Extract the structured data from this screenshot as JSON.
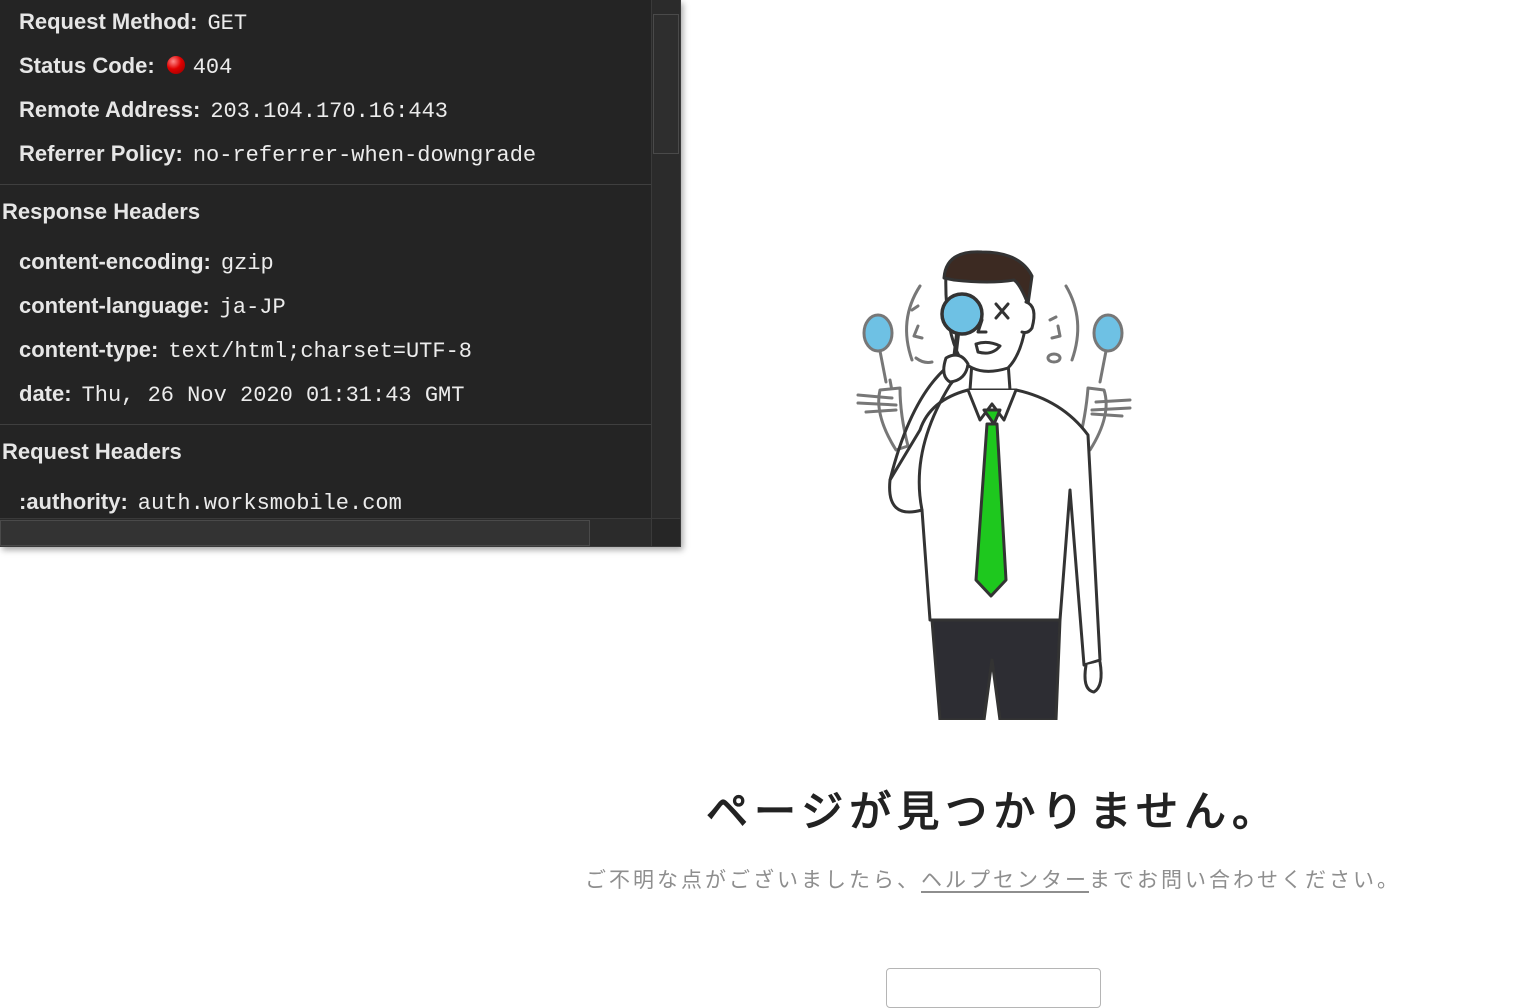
{
  "devtools": {
    "general": [
      {
        "key": "Request Method:",
        "value": "GET"
      },
      {
        "key": "Status Code:",
        "value": "404"
      },
      {
        "key": "Remote Address:",
        "value": "203.104.170.16:443"
      },
      {
        "key": "Referrer Policy:",
        "value": "no-referrer-when-downgrade"
      }
    ],
    "response_headers": {
      "title": "Response Headers",
      "items": [
        {
          "key": "content-encoding:",
          "value": "gzip"
        },
        {
          "key": "content-language:",
          "value": "ja-JP"
        },
        {
          "key": "content-type:",
          "value": "text/html;charset=UTF-8"
        },
        {
          "key": "date:",
          "value": "Thu, 26 Nov 2020 01:31:43 GMT"
        }
      ]
    },
    "request_headers": {
      "title": "Request Headers",
      "items": [
        {
          "key": ":authority:",
          "value": "auth.worksmobile.com"
        }
      ]
    },
    "status_color": "#e10000"
  },
  "error_page": {
    "title": "ページが見つかりません。",
    "message_before": "ご不明な点がございましたら、",
    "help_link": "ヘルプセンター",
    "message_after": "までお問い合わせください。",
    "tie_color": "#1ec81e",
    "lens_color": "#6ec1e4"
  }
}
